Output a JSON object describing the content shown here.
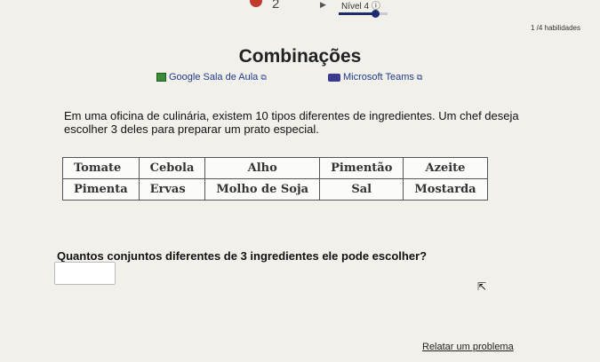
{
  "progress": {
    "current_question": "2",
    "level_label": "Nível 4 ⓘ",
    "level_progress": 0.75,
    "skills_text": "1 /4 habilidades"
  },
  "title": "Combinações",
  "links": {
    "google_classroom": "Google Sala de Aula",
    "microsoft_teams": "Microsoft Teams"
  },
  "prompt": "Em uma oficina de culinária, existem 10 tipos diferentes de ingredientes. Um chef deseja escolher 3 deles para preparar um prato especial.",
  "table": {
    "row1": [
      "Tomate",
      "Cebola",
      "Alho",
      "Pimentão",
      "Azeite"
    ],
    "row2": [
      "Pimenta",
      "Ervas",
      "Molho de Soja",
      "Sal",
      "Mostarda"
    ]
  },
  "question": "Quantos conjuntos diferentes de 3 ingredientes ele pode escolher?",
  "answer_value": "",
  "report_link": "Relatar um problema",
  "colors": {
    "accent": "#1d2a6b",
    "link": "#1f3a8a",
    "progress_dot": "#c0392b"
  }
}
